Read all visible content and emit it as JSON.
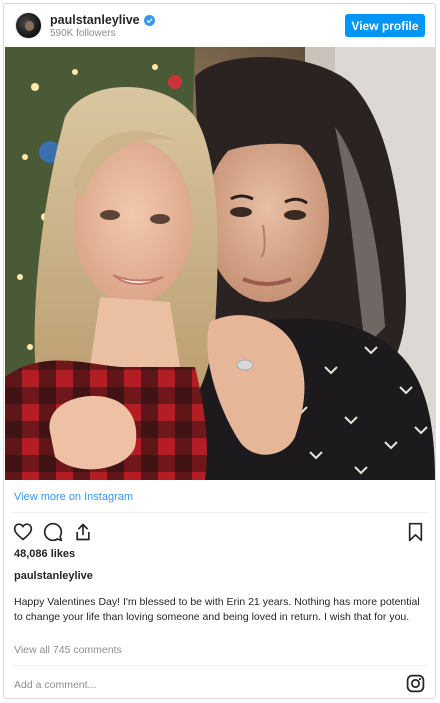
{
  "header": {
    "username": "paulstanleylive",
    "followers": "590K followers",
    "view_profile_label": "View profile"
  },
  "post": {
    "view_more_label": "View more on Instagram",
    "likes": "48,086 likes",
    "caption_username": "paulstanleylive",
    "caption": "Happy Valentines Day! I'm blessed to be with Erin 21 years. Nothing has more potential to change your life than loving someone and being loved in return. I wish that for you.",
    "view_comments_label": "View all 745 comments",
    "add_comment_placeholder": "Add a comment..."
  },
  "colors": {
    "accent": "#0095f6",
    "link": "#3897f0",
    "muted": "#8e8e8e",
    "verified": "#3897f0"
  },
  "icons": [
    "verified-badge-icon",
    "heart-icon",
    "comment-icon",
    "share-icon",
    "bookmark-icon",
    "instagram-logo-icon"
  ]
}
